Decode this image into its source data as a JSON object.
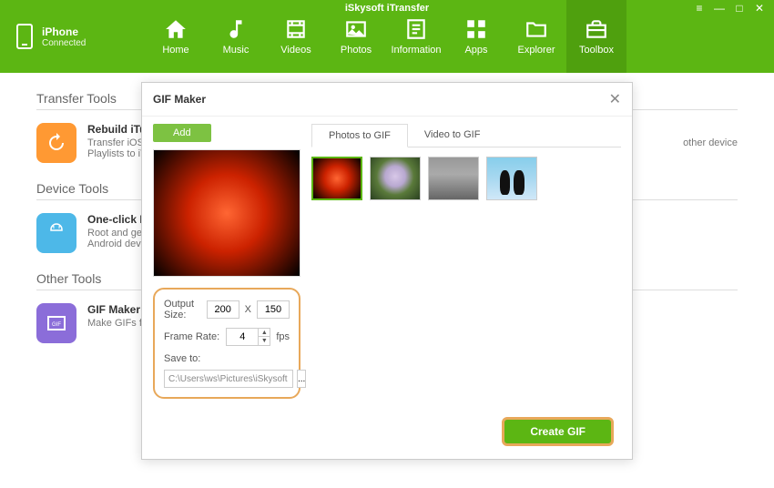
{
  "app": {
    "title": "iSkysoft iTransfer"
  },
  "device": {
    "name": "iPhone",
    "status": "Connected"
  },
  "nav": [
    {
      "label": "Home"
    },
    {
      "label": "Music"
    },
    {
      "label": "Videos"
    },
    {
      "label": "Photos"
    },
    {
      "label": "Information"
    },
    {
      "label": "Apps"
    },
    {
      "label": "Explorer"
    },
    {
      "label": "Toolbox"
    }
  ],
  "sections": {
    "transfer": {
      "title": "Transfer Tools"
    },
    "device_tools": {
      "title": "Device Tools"
    },
    "other": {
      "title": "Other Tools"
    }
  },
  "tools": {
    "rebuild": {
      "name": "Rebuild iTunes Library",
      "desc1": "Transfer iOS/Android Music, Movies,",
      "desc2": "Playlists to iTunes",
      "trailing": "other device"
    },
    "oneclick": {
      "name": "One-click Root",
      "desc1": "Root and get full control of your",
      "desc2": "Android device"
    },
    "gifmaker": {
      "name": "GIF Maker",
      "desc1": "Make GIFs from photos or videos"
    }
  },
  "modal": {
    "title": "GIF Maker",
    "add": "Add",
    "tabs": {
      "photos": "Photos to GIF",
      "video": "Video to GIF"
    },
    "settings": {
      "output_label": "Output Size:",
      "width": "200",
      "x": "X",
      "height": "150",
      "frame_label": "Frame Rate:",
      "fps_value": "4",
      "fps_unit": "fps",
      "save_label": "Save to:",
      "path": "C:\\Users\\ws\\Pictures\\iSkysoft iTr..."
    },
    "create": "Create GIF"
  }
}
